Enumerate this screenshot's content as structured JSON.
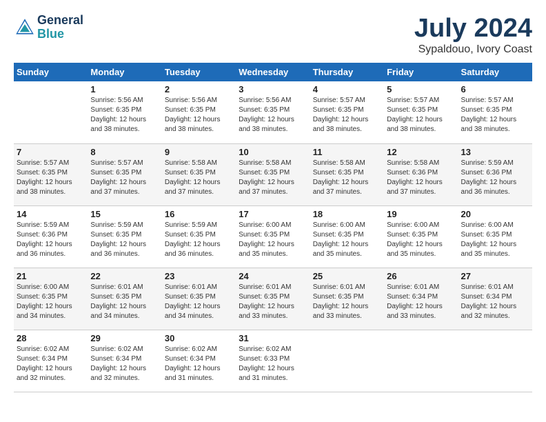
{
  "header": {
    "logo_line1": "General",
    "logo_line2": "Blue",
    "month": "July 2024",
    "location": "Sypaldouo, Ivory Coast"
  },
  "weekdays": [
    "Sunday",
    "Monday",
    "Tuesday",
    "Wednesday",
    "Thursday",
    "Friday",
    "Saturday"
  ],
  "weeks": [
    [
      {
        "day": "",
        "info": ""
      },
      {
        "day": "1",
        "info": "Sunrise: 5:56 AM\nSunset: 6:35 PM\nDaylight: 12 hours\nand 38 minutes."
      },
      {
        "day": "2",
        "info": "Sunrise: 5:56 AM\nSunset: 6:35 PM\nDaylight: 12 hours\nand 38 minutes."
      },
      {
        "day": "3",
        "info": "Sunrise: 5:56 AM\nSunset: 6:35 PM\nDaylight: 12 hours\nand 38 minutes."
      },
      {
        "day": "4",
        "info": "Sunrise: 5:57 AM\nSunset: 6:35 PM\nDaylight: 12 hours\nand 38 minutes."
      },
      {
        "day": "5",
        "info": "Sunrise: 5:57 AM\nSunset: 6:35 PM\nDaylight: 12 hours\nand 38 minutes."
      },
      {
        "day": "6",
        "info": "Sunrise: 5:57 AM\nSunset: 6:35 PM\nDaylight: 12 hours\nand 38 minutes."
      }
    ],
    [
      {
        "day": "7",
        "info": "Sunrise: 5:57 AM\nSunset: 6:35 PM\nDaylight: 12 hours\nand 38 minutes."
      },
      {
        "day": "8",
        "info": "Sunrise: 5:57 AM\nSunset: 6:35 PM\nDaylight: 12 hours\nand 37 minutes."
      },
      {
        "day": "9",
        "info": "Sunrise: 5:58 AM\nSunset: 6:35 PM\nDaylight: 12 hours\nand 37 minutes."
      },
      {
        "day": "10",
        "info": "Sunrise: 5:58 AM\nSunset: 6:35 PM\nDaylight: 12 hours\nand 37 minutes."
      },
      {
        "day": "11",
        "info": "Sunrise: 5:58 AM\nSunset: 6:35 PM\nDaylight: 12 hours\nand 37 minutes."
      },
      {
        "day": "12",
        "info": "Sunrise: 5:58 AM\nSunset: 6:36 PM\nDaylight: 12 hours\nand 37 minutes."
      },
      {
        "day": "13",
        "info": "Sunrise: 5:59 AM\nSunset: 6:36 PM\nDaylight: 12 hours\nand 36 minutes."
      }
    ],
    [
      {
        "day": "14",
        "info": "Sunrise: 5:59 AM\nSunset: 6:36 PM\nDaylight: 12 hours\nand 36 minutes."
      },
      {
        "day": "15",
        "info": "Sunrise: 5:59 AM\nSunset: 6:35 PM\nDaylight: 12 hours\nand 36 minutes."
      },
      {
        "day": "16",
        "info": "Sunrise: 5:59 AM\nSunset: 6:35 PM\nDaylight: 12 hours\nand 36 minutes."
      },
      {
        "day": "17",
        "info": "Sunrise: 6:00 AM\nSunset: 6:35 PM\nDaylight: 12 hours\nand 35 minutes."
      },
      {
        "day": "18",
        "info": "Sunrise: 6:00 AM\nSunset: 6:35 PM\nDaylight: 12 hours\nand 35 minutes."
      },
      {
        "day": "19",
        "info": "Sunrise: 6:00 AM\nSunset: 6:35 PM\nDaylight: 12 hours\nand 35 minutes."
      },
      {
        "day": "20",
        "info": "Sunrise: 6:00 AM\nSunset: 6:35 PM\nDaylight: 12 hours\nand 35 minutes."
      }
    ],
    [
      {
        "day": "21",
        "info": "Sunrise: 6:00 AM\nSunset: 6:35 PM\nDaylight: 12 hours\nand 34 minutes."
      },
      {
        "day": "22",
        "info": "Sunrise: 6:01 AM\nSunset: 6:35 PM\nDaylight: 12 hours\nand 34 minutes."
      },
      {
        "day": "23",
        "info": "Sunrise: 6:01 AM\nSunset: 6:35 PM\nDaylight: 12 hours\nand 34 minutes."
      },
      {
        "day": "24",
        "info": "Sunrise: 6:01 AM\nSunset: 6:35 PM\nDaylight: 12 hours\nand 33 minutes."
      },
      {
        "day": "25",
        "info": "Sunrise: 6:01 AM\nSunset: 6:35 PM\nDaylight: 12 hours\nand 33 minutes."
      },
      {
        "day": "26",
        "info": "Sunrise: 6:01 AM\nSunset: 6:34 PM\nDaylight: 12 hours\nand 33 minutes."
      },
      {
        "day": "27",
        "info": "Sunrise: 6:01 AM\nSunset: 6:34 PM\nDaylight: 12 hours\nand 32 minutes."
      }
    ],
    [
      {
        "day": "28",
        "info": "Sunrise: 6:02 AM\nSunset: 6:34 PM\nDaylight: 12 hours\nand 32 minutes."
      },
      {
        "day": "29",
        "info": "Sunrise: 6:02 AM\nSunset: 6:34 PM\nDaylight: 12 hours\nand 32 minutes."
      },
      {
        "day": "30",
        "info": "Sunrise: 6:02 AM\nSunset: 6:34 PM\nDaylight: 12 hours\nand 31 minutes."
      },
      {
        "day": "31",
        "info": "Sunrise: 6:02 AM\nSunset: 6:33 PM\nDaylight: 12 hours\nand 31 minutes."
      },
      {
        "day": "",
        "info": ""
      },
      {
        "day": "",
        "info": ""
      },
      {
        "day": "",
        "info": ""
      }
    ]
  ]
}
